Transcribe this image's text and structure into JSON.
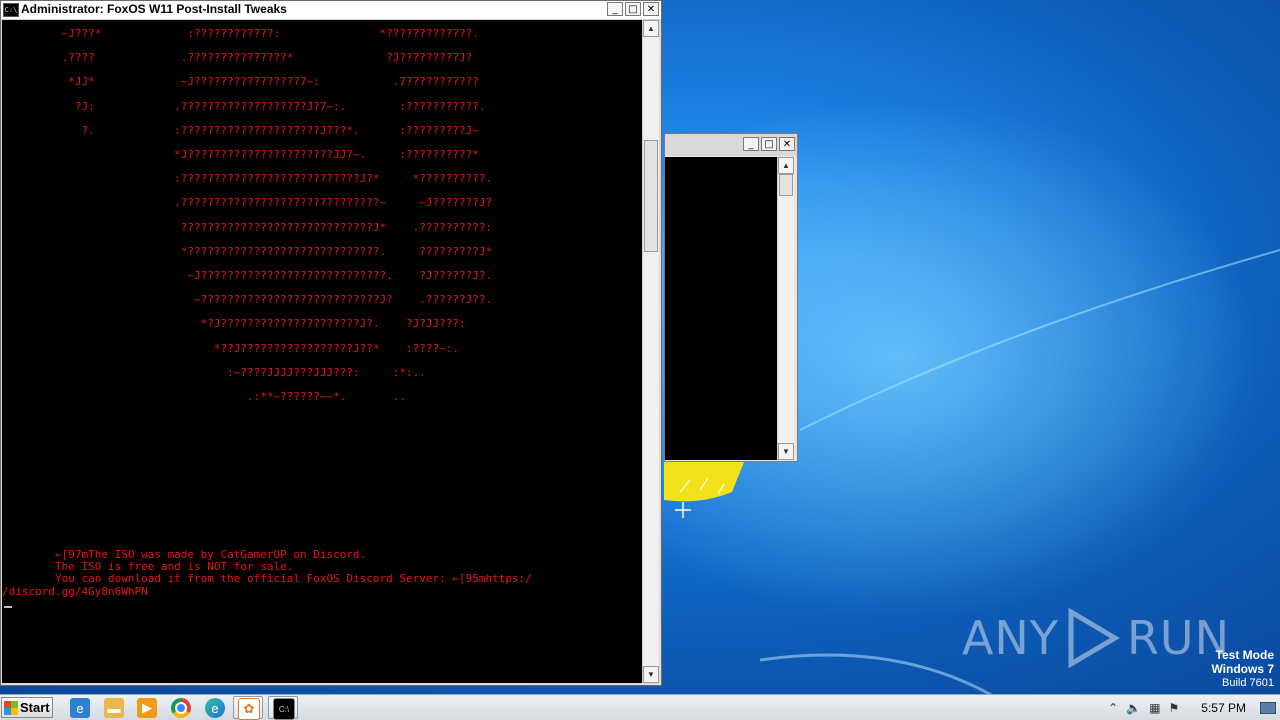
{
  "console": {
    "title": "Administrator:  FoxOS W11 Post-Install Tweaks",
    "art_lines": [
      "         ~J???*             :????????????:               *?????????????.",
      "         .????             .???????????????*              ?J?????????J?",
      "          *JJ*             ~J????????????????7~:           .7???????????",
      "           ?J:            .???????????????????J?7~:.        :???????????.",
      "            ?.            :?????????????????????J???*.      :?????????J~",
      "                          *J??????????????????????JJ?~.     :??????????*",
      "                          :???????????????????????????J?*     *??????????.",
      "                          .??????????????????????????????~     ~J???????J?",
      "                           ?????????????????????????????J*    .??????????:",
      "                           *?????????????????????????????.     ?????????J*",
      "                            ~J????????????????????????????.    ?J??????J?.",
      "                             ~???????????????????????????J?    .??????J??.",
      "                              *?J?????????????????????J?.    ?J?JJ???:",
      "                                *??J?????????????????J??*    :????~:.",
      "                                  :~????JJJJ???JJJ???:     :*:..",
      "                                     .:**~??????~~*.       .."
    ],
    "message_lines": [
      "        ←[97mThe ISO was made by CatGamerOP on Discord.",
      "        The ISO is free and is NOT for sale.",
      "        You can download it from the official FoxOS Discord Server: ←[95mhttps:/",
      "/discord.gg/4Gy8n6WhPN"
    ],
    "text_color": "#e8141a",
    "caption_buttons": [
      "_",
      "□",
      "✕"
    ]
  },
  "second_window": {
    "caption_buttons": [
      "_",
      "□",
      "✕"
    ]
  },
  "watermark": {
    "brand_left": "ANY",
    "brand_right": "RUN"
  },
  "system_info": {
    "line1": "Test Mode",
    "line2": "Windows 7",
    "line3": "Build 7601"
  },
  "taskbar": {
    "start_label": "Start",
    "pinned": [
      "internet-explorer",
      "file-explorer",
      "media-player",
      "chrome",
      "edge",
      "foxos-app",
      "command-prompt"
    ],
    "clock": "5:57 PM"
  }
}
